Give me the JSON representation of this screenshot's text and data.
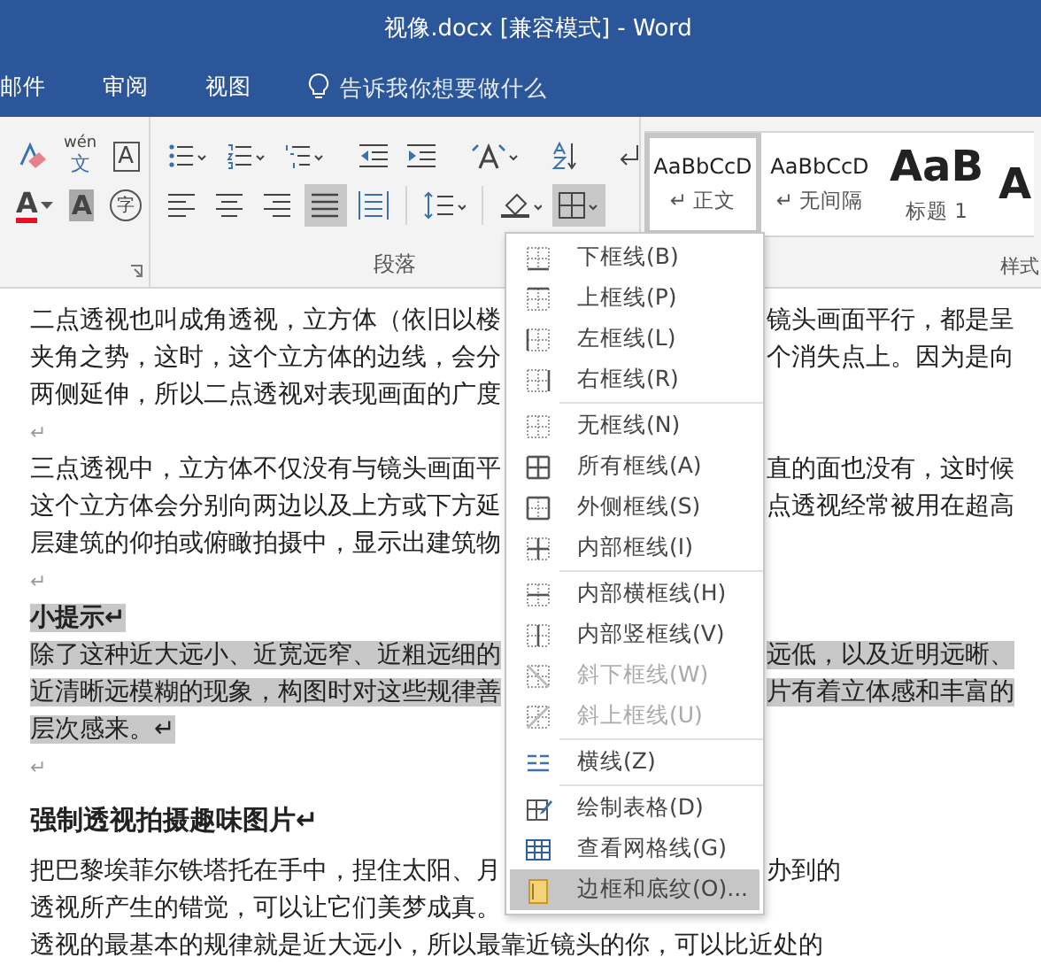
{
  "window": {
    "title": "视像.docx [兼容模式]  -  Word"
  },
  "tabs": [
    {
      "label": "邮件",
      "selected": false
    },
    {
      "label": "审阅",
      "selected": false
    },
    {
      "label": "视图",
      "selected": false
    }
  ],
  "tell_me": {
    "placeholder": "告诉我你想要做什么"
  },
  "ribbon": {
    "font_tools_row1": [
      {
        "kind": "clear-format"
      },
      {
        "kind": "phonetic",
        "text": "wén",
        "sub": "文"
      },
      {
        "kind": "char-border",
        "text": "A"
      }
    ],
    "font_tools_row2": [
      {
        "kind": "font-color",
        "text": "A",
        "color": "#e81123"
      },
      {
        "kind": "char-shading",
        "text": "A"
      },
      {
        "kind": "enclose",
        "text": "字"
      }
    ],
    "paragraph_row1": [
      {
        "kind": "bullets",
        "selected": false
      },
      {
        "kind": "numbering",
        "selected": false
      },
      {
        "kind": "multilevel",
        "selected": false
      },
      {
        "kind": "sep"
      },
      {
        "kind": "outdent",
        "selected": false
      },
      {
        "kind": "indent",
        "selected": false
      },
      {
        "kind": "sep"
      },
      {
        "kind": "asian-layout",
        "selected": false
      },
      {
        "kind": "sep"
      },
      {
        "kind": "sort",
        "selected": false
      },
      {
        "kind": "sep"
      },
      {
        "kind": "show-marks",
        "selected": false
      }
    ],
    "paragraph_row2": [
      {
        "kind": "align-left",
        "selected": false
      },
      {
        "kind": "align-center",
        "selected": false
      },
      {
        "kind": "align-right",
        "selected": false
      },
      {
        "kind": "justify",
        "selected": true
      },
      {
        "kind": "distribute",
        "selected": false
      },
      {
        "kind": "sep"
      },
      {
        "kind": "line-spacing",
        "selected": false
      },
      {
        "kind": "sep"
      },
      {
        "kind": "shading",
        "selected": false
      },
      {
        "kind": "borders",
        "selected": true
      }
    ],
    "paragraph_label": "段落",
    "styles": [
      {
        "preview": "AaBbCcD",
        "name": "↵ 正文",
        "kind": "normal",
        "selected": true
      },
      {
        "preview": "AaBbCcD",
        "name": "↵ 无间隔",
        "kind": "normal",
        "selected": false
      },
      {
        "preview": "AaB",
        "name": "标题 1",
        "kind": "heading",
        "selected": false
      },
      {
        "preview": "A",
        "kind": "heading",
        "selected": false
      }
    ],
    "styles_label": "样式"
  },
  "border_menu": {
    "items": [
      {
        "kind": "bottom",
        "label": "下框线(B)",
        "disabled": false,
        "selected": false,
        "separator_before": false
      },
      {
        "kind": "top",
        "label": "上框线(P)",
        "disabled": false,
        "selected": false,
        "separator_before": false
      },
      {
        "kind": "left",
        "label": "左框线(L)",
        "disabled": false,
        "selected": false,
        "separator_before": false
      },
      {
        "kind": "right",
        "label": "右框线(R)",
        "disabled": false,
        "selected": false,
        "separator_before": false
      },
      {
        "kind": "none",
        "label": "无框线(N)",
        "disabled": false,
        "selected": false,
        "separator_before": true
      },
      {
        "kind": "all",
        "label": "所有框线(A)",
        "disabled": false,
        "selected": false,
        "separator_before": false
      },
      {
        "kind": "outside",
        "label": "外侧框线(S)",
        "disabled": false,
        "selected": false,
        "separator_before": false
      },
      {
        "kind": "inside",
        "label": "内部框线(I)",
        "disabled": false,
        "selected": false,
        "separator_before": false
      },
      {
        "kind": "inside-h",
        "label": "内部横框线(H)",
        "disabled": false,
        "selected": false,
        "separator_before": true
      },
      {
        "kind": "inside-v",
        "label": "内部竖框线(V)",
        "disabled": false,
        "selected": false,
        "separator_before": false
      },
      {
        "kind": "diag-down",
        "label": "斜下框线(W)",
        "disabled": true,
        "selected": false,
        "separator_before": false
      },
      {
        "kind": "diag-up",
        "label": "斜上框线(U)",
        "disabled": true,
        "selected": false,
        "separator_before": false
      },
      {
        "kind": "horizontal-line",
        "label": "横线(Z)",
        "disabled": false,
        "selected": false,
        "separator_before": true
      },
      {
        "kind": "draw-table",
        "label": "绘制表格(D)",
        "disabled": false,
        "selected": false,
        "separator_before": true
      },
      {
        "kind": "gridlines",
        "label": "查看网格线(G)",
        "disabled": false,
        "selected": false,
        "separator_before": false
      },
      {
        "kind": "borders-shading",
        "label": "边框和底纹(O)...",
        "disabled": false,
        "selected": true,
        "separator_before": false
      }
    ]
  },
  "document": {
    "lines": [
      {
        "kind": "body",
        "left": "二点透视也叫成角透视，立方体（依旧以楼",
        "right": "镜头画面平行，都是呈",
        "selected": false
      },
      {
        "kind": "body",
        "left": "夹角之势，这时，这个立方体的边线，会分",
        "right": "个消失点上。因为是向",
        "selected": false
      },
      {
        "kind": "body",
        "left": "两侧延伸，所以二点透视对表现画面的广度",
        "selected": false
      },
      {
        "kind": "mark",
        "left": "↵",
        "selected": false
      },
      {
        "kind": "body",
        "left": "三点透视中，立方体不仅没有与镜头画面平",
        "right": "直的面也没有，这时候",
        "selected": false
      },
      {
        "kind": "body",
        "left": "这个立方体会分别向两边以及上方或下方延",
        "right": "点透视经常被用在超高",
        "selected": false
      },
      {
        "kind": "body",
        "left": "层建筑的仰拍或俯瞰拍摄中，显示出建筑物",
        "selected": false
      },
      {
        "kind": "mark",
        "left": "↵",
        "selected": false
      },
      {
        "kind": "bold",
        "left": "小提示↵",
        "selected": true
      },
      {
        "kind": "body",
        "left": "除了这种近大远小、近宽远窄、近粗远细的",
        "right": "远低，以及近明远晰、",
        "selected": true
      },
      {
        "kind": "body",
        "left": "近清晰远模糊的现象，构图时对这些规律善",
        "right": "片有着立体感和丰富的",
        "selected": true
      },
      {
        "kind": "body",
        "left": "层次感来。↵",
        "selected": true
      },
      {
        "kind": "mark",
        "left": "↵",
        "selected": false
      },
      {
        "kind": "heading",
        "left": "强制透视拍摄趣味图片↵",
        "selected": false
      },
      {
        "kind": "body",
        "left": "把巴黎埃菲尔铁塔托在手中，捏住太阳、月",
        "right": "办到的",
        "selected": false
      },
      {
        "kind": "body",
        "left": "透视所产生的错觉，可以让它们美梦成真。",
        "selected": false
      },
      {
        "kind": "body",
        "left": "透视的最基本的规律就是近大远小，所以最靠近镜头的你，可以比近处的",
        "selected": false
      }
    ]
  }
}
